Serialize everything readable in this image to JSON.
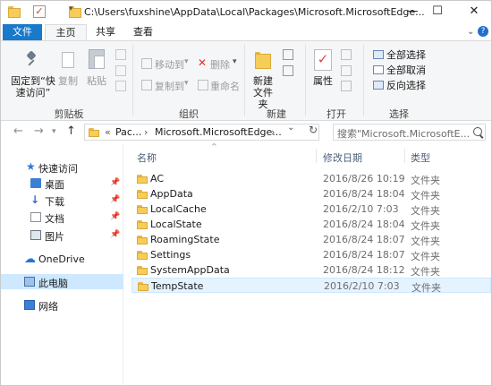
{
  "window": {
    "title": "C:\\Users\\fuxshine\\AppData\\Local\\Packages\\Microsoft.MicrosoftEdge...",
    "minimize": "—",
    "maximize": "☐",
    "close": "✕"
  },
  "ribbon_tabs": {
    "file": "文件",
    "home": "主页",
    "share": "共享",
    "view": "查看"
  },
  "ribbon": {
    "clipboard": {
      "pin": "固定到“快速访问”",
      "copy": "复制",
      "paste": "粘贴",
      "group": "剪贴板"
    },
    "organize": {
      "move_to": "移动到",
      "copy_to": "复制到",
      "delete": "删除",
      "rename": "重命名",
      "group": "组织"
    },
    "new": {
      "new_folder": "新建文件夹",
      "group": "新建"
    },
    "open": {
      "properties": "属性",
      "group": "打开"
    },
    "select": {
      "select_all": "全部选择",
      "select_none": "全部取消",
      "invert": "反向选择",
      "group": "选择"
    }
  },
  "address": {
    "crumbs": [
      "«",
      "Pac...",
      "›",
      "Microsoft.MicrosoftEdge...",
      "›"
    ],
    "search_placeholder": "搜索\"Microsoft.MicrosoftE..."
  },
  "nav": {
    "items": [
      {
        "label": "快速访问",
        "icon": "star-icon"
      },
      {
        "label": "桌面",
        "icon": "desktop-icon",
        "pinned": true
      },
      {
        "label": "下载",
        "icon": "download-icon",
        "pinned": true
      },
      {
        "label": "文档",
        "icon": "documents-icon",
        "pinned": true
      },
      {
        "label": "图片",
        "icon": "pictures-icon",
        "pinned": true
      },
      {
        "label": "OneDrive",
        "icon": "onedrive-icon"
      },
      {
        "label": "此电脑",
        "icon": "this-pc-icon",
        "selected": true
      },
      {
        "label": "网络",
        "icon": "network-icon"
      }
    ]
  },
  "list": {
    "headers": {
      "name": "名称",
      "modified": "修改日期",
      "type": "类型"
    },
    "rows": [
      {
        "name": "AC",
        "modified": "2016/8/26 10:19",
        "type": "文件夹"
      },
      {
        "name": "AppData",
        "modified": "2016/8/24 18:04",
        "type": "文件夹"
      },
      {
        "name": "LocalCache",
        "modified": "2016/2/10 7:03",
        "type": "文件夹"
      },
      {
        "name": "LocalState",
        "modified": "2016/8/24 18:04",
        "type": "文件夹"
      },
      {
        "name": "RoamingState",
        "modified": "2016/8/24 18:07",
        "type": "文件夹"
      },
      {
        "name": "Settings",
        "modified": "2016/8/24 18:07",
        "type": "文件夹"
      },
      {
        "name": "SystemAppData",
        "modified": "2016/8/24 18:12",
        "type": "文件夹"
      },
      {
        "name": "TempState",
        "modified": "2016/2/10 7:03",
        "type": "文件夹",
        "selected": true
      }
    ]
  },
  "colors": {
    "accent": "#1979ca",
    "selected_nav": "#cde8ff",
    "selected_row": "#e5f3ff",
    "folder": "#f6cd57"
  }
}
